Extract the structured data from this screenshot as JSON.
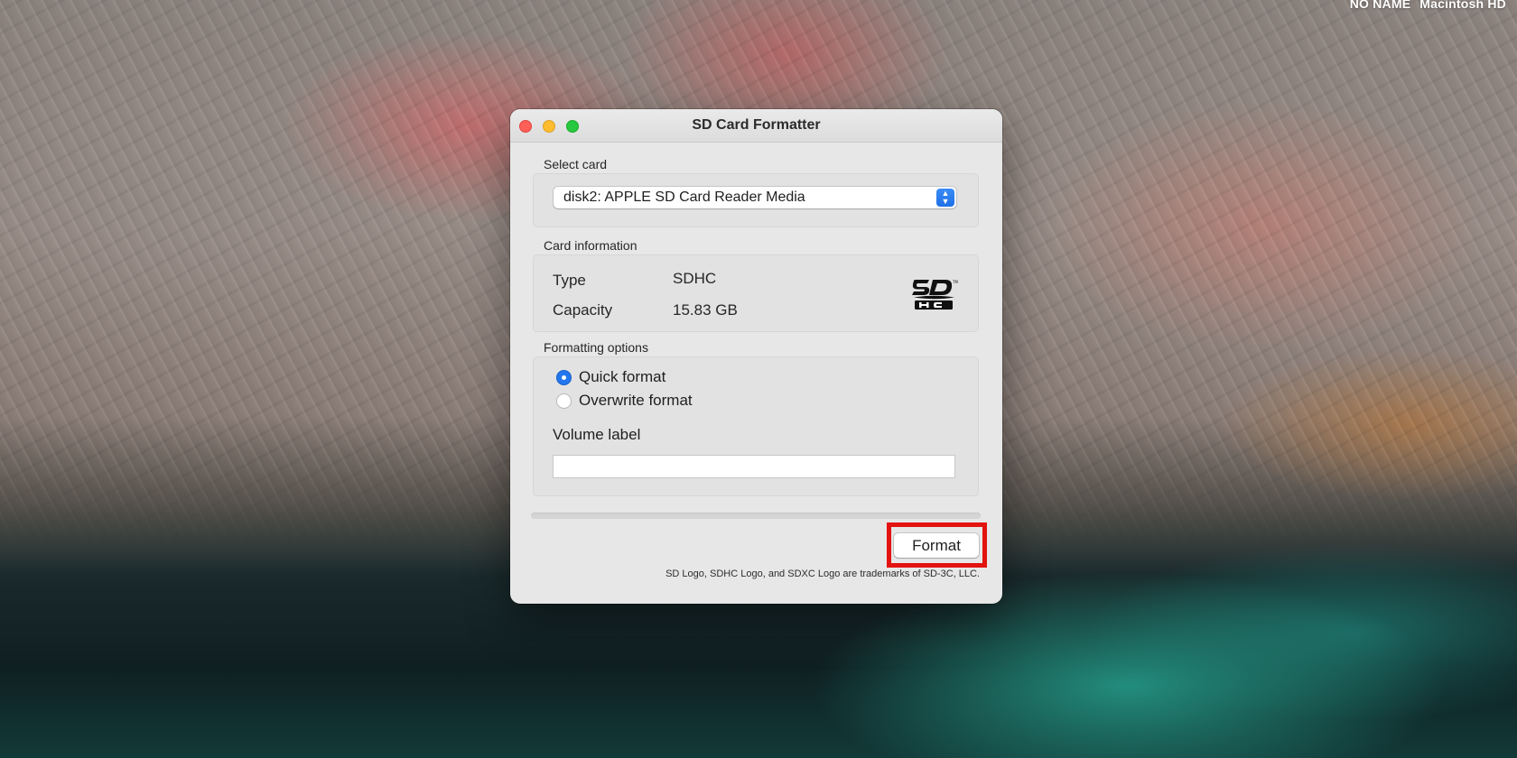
{
  "menubar": {
    "volumes": [
      "NO NAME",
      "Macintosh HD"
    ]
  },
  "window": {
    "title": "SD Card Formatter"
  },
  "select_card": {
    "label": "Select card",
    "selected": "disk2: APPLE SD Card Reader Media"
  },
  "card_info": {
    "label": "Card information",
    "type_key": "Type",
    "type_value": "SDHC",
    "capacity_key": "Capacity",
    "capacity_value": "15.83 GB",
    "logo": "sdhc-logo"
  },
  "formatting": {
    "label": "Formatting options",
    "options": [
      {
        "label": "Quick format",
        "selected": true
      },
      {
        "label": "Overwrite format",
        "selected": false
      }
    ],
    "volume_label": "Volume label",
    "volume_value": ""
  },
  "progress": 0,
  "actions": {
    "format_label": "Format"
  },
  "footer": {
    "trademark": "SD Logo, SDHC Logo, and SDXC Logo are trademarks of SD-3C, LLC."
  },
  "colors": {
    "accent": "#2277EE",
    "highlight": "#E3130F",
    "close": "#FE5F57",
    "minimize": "#FEBC2E",
    "zoom": "#28C840"
  }
}
